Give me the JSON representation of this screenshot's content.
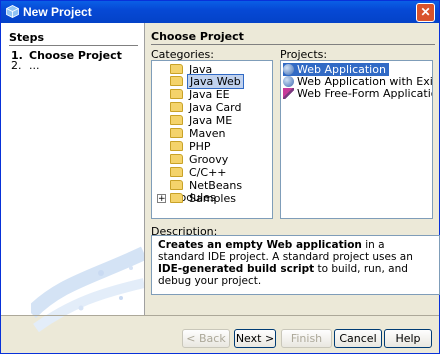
{
  "window": {
    "title": "New Project",
    "close_glyph": "✕"
  },
  "steps": {
    "title": "Steps",
    "items": [
      {
        "num": "1.",
        "label": "Choose Project"
      },
      {
        "num": "2.",
        "label": "..."
      }
    ]
  },
  "content": {
    "title": "Choose Project",
    "categories_label": "Categories:",
    "projects_label": "Projects:",
    "categories": [
      "Java",
      "Java Web",
      "Java EE",
      "Java Card",
      "Java ME",
      "Maven",
      "PHP",
      "Groovy",
      "C/C++",
      "NetBeans Modules",
      "Samples"
    ],
    "selected_category": "Java Web",
    "projects": [
      {
        "label": "Web Application",
        "icon": "globe-icon"
      },
      {
        "label": "Web Application with Existing Sources",
        "icon": "globe-icon"
      },
      {
        "label": "Web Free-Form Application",
        "icon": "brush-icon"
      }
    ],
    "description_label": "Description:",
    "description": {
      "p1": "Creates an empty Web application",
      "p2": " in a standard IDE project. A standard project uses an ",
      "p3": "IDE-generated build script",
      "p4": " to build, run, and debug your project."
    }
  },
  "buttons": {
    "back": "< Back",
    "next": "Next >",
    "finish": "Finish",
    "cancel": "Cancel",
    "help": "Help"
  },
  "colors": {
    "titlebar": "#0649d5",
    "selection": "#316ac5",
    "dialog_bg": "#ece9d8"
  }
}
